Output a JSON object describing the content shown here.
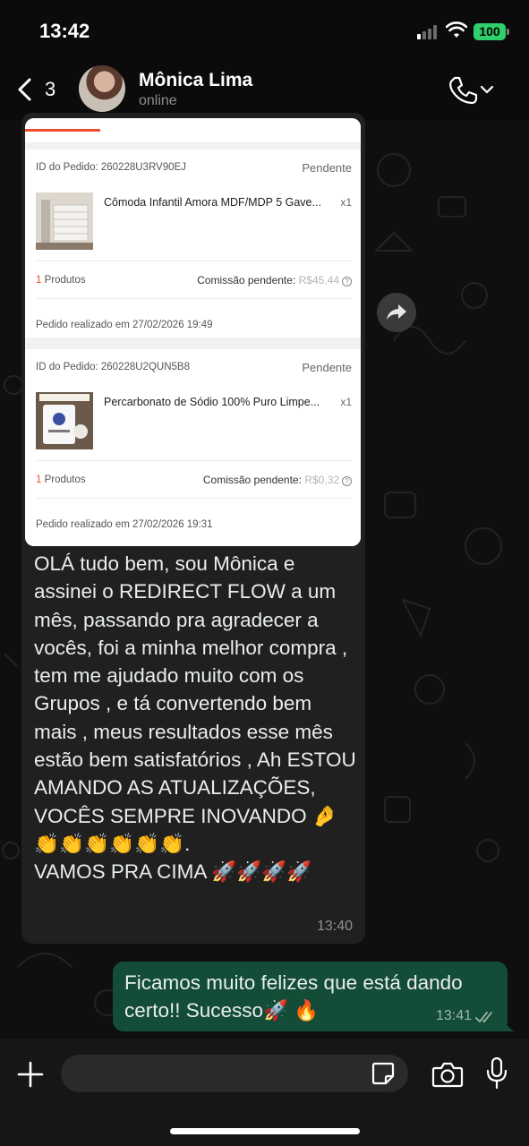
{
  "status_bar": {
    "time": "13:42",
    "battery": "100"
  },
  "header": {
    "back_count": "3",
    "contact_name": "Mônica Lima",
    "contact_status": "online"
  },
  "incoming_message": {
    "orders": [
      {
        "id_label": "ID do Pedido: 260228U3RV90EJ",
        "status": "Pendente",
        "product_name": "Cômoda Infantil Amora MDF/MDP 5 Gave...",
        "quantity": "x1",
        "products_count": "1",
        "products_label": "Produtos",
        "commission_label": "Comissão pendente:",
        "commission_value": "R$45,44",
        "order_date": "Pedido realizado em 27/02/2026 19:49"
      },
      {
        "id_label": "ID do Pedido: 260228U2QUN5B8",
        "status": "Pendente",
        "product_name": "Percarbonato de Sódio 100% Puro Limpe...",
        "quantity": "x1",
        "products_count": "1",
        "products_label": "Produtos",
        "commission_label": "Comissão pendente:",
        "commission_value": "R$0,32",
        "order_date": "Pedido realizado em 27/02/2026 19:31"
      }
    ],
    "text": "OLÁ tudo bem, sou Mônica e assinei o REDIRECT FLOW a um mês, passando pra agradecer a vocês, foi a minha melhor compra , tem me ajudado muito com os Grupos , e tá convertendo bem mais , meus resultados esse mês estão bem satisfatórios , Ah ESTOU AMANDO AS ATUALIZAÇÕES, VOCÊS SEMPRE INOVANDO 🤌 👏👏👏👏👏👏.\nVAMOS PRA CIMA 🚀🚀🚀🚀",
    "time": "13:40"
  },
  "outgoing_message": {
    "text": "Ficamos muito felizes que está dando certo!! Sucesso🚀 🔥",
    "time": "13:41"
  },
  "input_bar": {
    "placeholder": ""
  },
  "colors": {
    "accent_orange": "#ee4d2d",
    "outgoing_bubble": "#134d37",
    "incoming_bubble": "#202020",
    "battery": "#2dd06b"
  }
}
